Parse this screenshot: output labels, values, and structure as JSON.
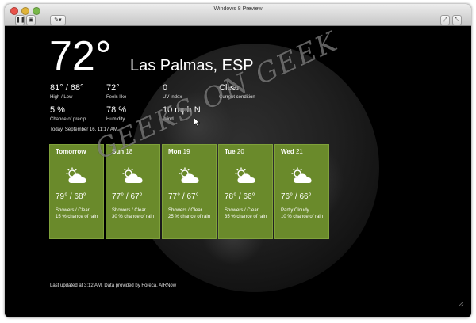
{
  "window": {
    "title": "Windows 8 Preview"
  },
  "current": {
    "temp": "72°",
    "location": "Las Palmas, ESP",
    "stats": [
      {
        "value": "81° / 68°",
        "label": "High / Low"
      },
      {
        "value": "72°",
        "label": "Feels like"
      },
      {
        "value": "0",
        "label": "UV index"
      },
      {
        "value": "Clear",
        "label": "Current condition"
      },
      {
        "value": "5 %",
        "label": "Chance of precip."
      },
      {
        "value": "78 %",
        "label": "Humidity"
      },
      {
        "value": "10 mph N",
        "label": "Wind"
      }
    ],
    "date": "Today, September 16, 11:17 AM"
  },
  "forecast": [
    {
      "day": "Tomorrow",
      "num": "",
      "hilo": "79° / 68°",
      "cond": "Showers / Clear",
      "precip": "15 % chance of rain",
      "icon": "partly-cloudy-icon"
    },
    {
      "day": "Sun",
      "num": "18",
      "hilo": "77° / 67°",
      "cond": "Showers / Clear",
      "precip": "30 % chance of rain",
      "icon": "partly-cloudy-icon"
    },
    {
      "day": "Mon",
      "num": "19",
      "hilo": "77° / 67°",
      "cond": "Showers / Clear",
      "precip": "25 % chance of rain",
      "icon": "partly-cloudy-icon"
    },
    {
      "day": "Tue",
      "num": "20",
      "hilo": "78° / 66°",
      "cond": "Showers / Clear",
      "precip": "35 % chance of rain",
      "icon": "partly-cloudy-icon"
    },
    {
      "day": "Wed",
      "num": "21",
      "hilo": "76° / 66°",
      "cond": "Partly Cloudy",
      "precip": "10 % chance of rain",
      "icon": "partly-cloudy-icon"
    }
  ],
  "footer": "Last updated at 3:12 AM. Data provided by Foreca, AIRNow",
  "watermark": "GEEKS ON GEEK",
  "colors": {
    "tile": "#6a8a2b",
    "background": "#000000"
  }
}
